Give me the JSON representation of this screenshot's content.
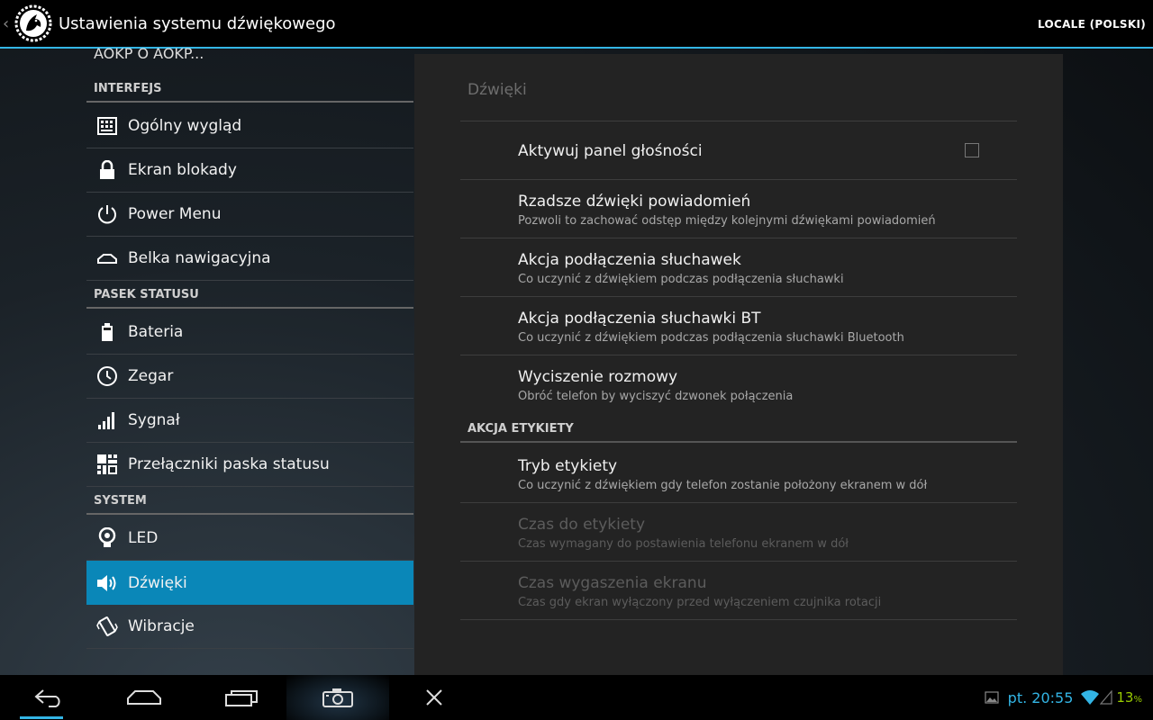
{
  "actionbar": {
    "title": "Ustawienia systemu dźwiękowego",
    "locale_button": "LOCALE (POLSKI)"
  },
  "left": {
    "cut_item": "AOKP  O AOKP...",
    "sections": [
      {
        "header": "INTERFEJS",
        "items": [
          {
            "label": "Ogólny wygląd",
            "icon": "keyboard-grid-icon"
          },
          {
            "label": "Ekran blokady",
            "icon": "lock-icon"
          },
          {
            "label": "Power Menu",
            "icon": "power-icon"
          },
          {
            "label": "Belka nawigacyjna",
            "icon": "home-bar-icon"
          }
        ]
      },
      {
        "header": "PASEK STATUSU",
        "items": [
          {
            "label": "Bateria",
            "icon": "battery-icon"
          },
          {
            "label": "Zegar",
            "icon": "clock-icon"
          },
          {
            "label": "Sygnał",
            "icon": "signal-icon"
          },
          {
            "label": "Przełączniki paska statusu",
            "icon": "toggles-icon"
          }
        ]
      },
      {
        "header": "SYSTEM",
        "items": [
          {
            "label": "LED",
            "icon": "bulb-icon"
          },
          {
            "label": "Dźwięki",
            "icon": "speaker-icon",
            "selected": true
          },
          {
            "label": "Wibracje",
            "icon": "vibrate-icon"
          }
        ]
      }
    ]
  },
  "panel": {
    "title": "Dźwięki",
    "prefs": [
      {
        "title": "Aktywuj panel głośności",
        "summary": "",
        "checkbox": true,
        "checked": false
      },
      {
        "title": "Rzadsze dźwięki powiadomień",
        "summary": "Pozwoli to zachować odstęp między kolejnymi dźwiękami powiadomień"
      },
      {
        "title": "Akcja podłączenia słuchawek",
        "summary": "Co uczynić z dźwiękiem podczas podłączenia słuchawki"
      },
      {
        "title": "Akcja podłączenia słuchawki BT",
        "summary": "Co uczynić z dźwiękiem podczas podłączenia słuchawki Bluetooth"
      },
      {
        "title": "Wyciszenie rozmowy",
        "summary": "Obróć telefon by wyciszyć dzwonek połączenia"
      }
    ],
    "category": "AKCJA ETYKIETY",
    "prefs2": [
      {
        "title": "Tryb etykiety",
        "summary": "Co uczynić z dźwiękiem gdy telefon zostanie położony ekranem w dół",
        "disabled": false
      },
      {
        "title": "Czas do etykiety",
        "summary": "Czas wymagany do postawienia telefonu ekranem w dół",
        "disabled": true
      },
      {
        "title": "Czas wygaszenia ekranu",
        "summary": "Czas gdy ekran wyłączony przed wyłączeniem czujnika rotacji",
        "disabled": true
      }
    ]
  },
  "statusbar": {
    "time": "pt. 20:55",
    "battery_value": "13",
    "battery_unit": "%"
  },
  "colors": {
    "accent": "#33b5e5",
    "selected_item": "#0a87b8",
    "battery": "#99cc00"
  }
}
